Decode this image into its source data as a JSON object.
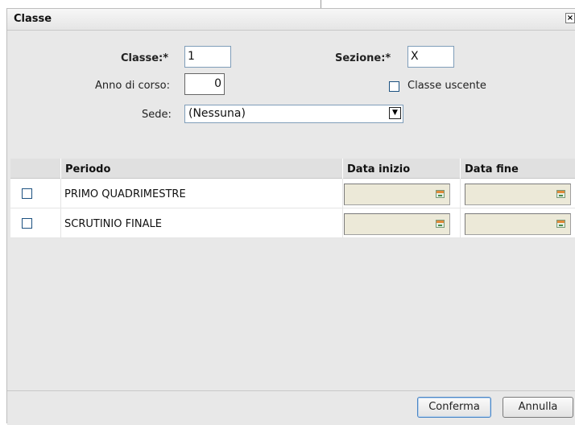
{
  "dialog": {
    "title": "Classe",
    "close_glyph": "×"
  },
  "form": {
    "classe_label": "Classe:*",
    "classe_value": "1",
    "sezione_label": "Sezione:*",
    "sezione_value": "X",
    "anno_label": "Anno di corso:",
    "anno_value": "0",
    "uscente_label": "Classe uscente",
    "uscente_checked": false,
    "sede_label": "Sede:",
    "sede_value": "(Nessuna)"
  },
  "grid": {
    "columns": [
      "",
      "Periodo",
      "Data inizio",
      "Data fine"
    ],
    "rows": [
      {
        "checked": false,
        "periodo": "PRIMO QUADRIMESTRE",
        "data_inizio": "",
        "data_fine": ""
      },
      {
        "checked": false,
        "periodo": "SCRUTINIO FINALE",
        "data_inizio": "",
        "data_fine": ""
      }
    ]
  },
  "footer": {
    "confirm_label": "Conferma",
    "cancel_label": "Annulla"
  },
  "icons": {
    "close": "close-icon",
    "dropdown": "chevron-down-icon",
    "date_picker": "calendar-icon"
  }
}
